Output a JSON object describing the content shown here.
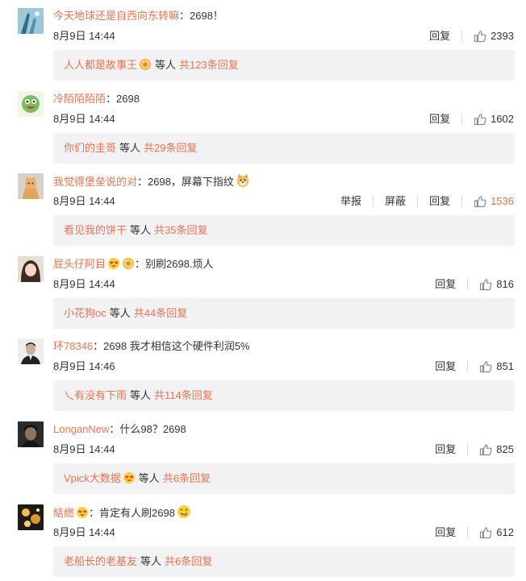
{
  "labels": {
    "reply": "回复",
    "report": "举报",
    "block": "屏蔽",
    "etc": "等人"
  },
  "comments": [
    {
      "username": "今天地球还是自西向东转嘛",
      "text": "：2698！",
      "time": "8月9日 14:44",
      "likes": "2393",
      "liked": false,
      "reply_user": "人人都是故事王",
      "reply_total": "共123条回复",
      "avatar_icon": "blue-sky-avatar",
      "badges": [],
      "reply_badge": "gold-medal-icon",
      "show_report": false
    },
    {
      "username": "冷陌陌陌陌",
      "text": "：2698",
      "time": "8月9日 14:44",
      "likes": "1602",
      "liked": false,
      "reply_user": "你们的圭哥",
      "reply_total": "共29条回复",
      "avatar_icon": "green-cartoon-avatar",
      "badges": [],
      "reply_badge": "",
      "show_report": false
    },
    {
      "username": "我觉得堡垒说的对",
      "text": "：2698，屏幕下指纹",
      "time": "8月9日 14:44",
      "likes": "1536",
      "liked": true,
      "reply_user": "看见我的饼干",
      "reply_total": "共35条回复",
      "avatar_icon": "cat-avatar",
      "badges": [],
      "text_emoji": "doge-emoji",
      "reply_badge": "",
      "show_report": true
    },
    {
      "username": "屁头仔阿目",
      "text": "：别刷2698.烦人",
      "time": "8月9日 14:44",
      "likes": "816",
      "liked": false,
      "reply_user": "小花狗oc",
      "reply_total": "共44条回复",
      "avatar_icon": "girl-photo-avatar",
      "badges": [
        "heart-eyes-emoji",
        "gold-medal-icon"
      ],
      "reply_badge": "",
      "show_report": false
    },
    {
      "username": "环78346",
      "text": "：2698  我才相信这个硬件利润5%",
      "time": "8月9日 14:46",
      "likes": "851",
      "liked": false,
      "reply_user": "乀有没有下雨",
      "reply_total": "共114条回复",
      "avatar_icon": "man-portrait-avatar",
      "badges": [],
      "reply_badge": "",
      "show_report": false
    },
    {
      "username": "LonganNew",
      "text": "：什么98？2698",
      "time": "8月9日 14:44",
      "likes": "825",
      "liked": false,
      "reply_user": "Vpick大数据",
      "reply_total": "共6条回复",
      "avatar_icon": "dark-portrait-avatar",
      "badges": [],
      "reply_badge": "heart-eyes-emoji",
      "show_report": false
    },
    {
      "username": "結繎",
      "text": "：肯定有人刷2698",
      "time": "8月9日 14:44",
      "likes": "612",
      "liked": false,
      "reply_user": "老船长的老基友",
      "reply_total": "共6条回复",
      "avatar_icon": "night-photo-avatar",
      "badges": [
        "heart-eyes-emoji"
      ],
      "text_emoji": "yummy-emoji",
      "reply_badge": "",
      "show_report": false
    }
  ]
}
